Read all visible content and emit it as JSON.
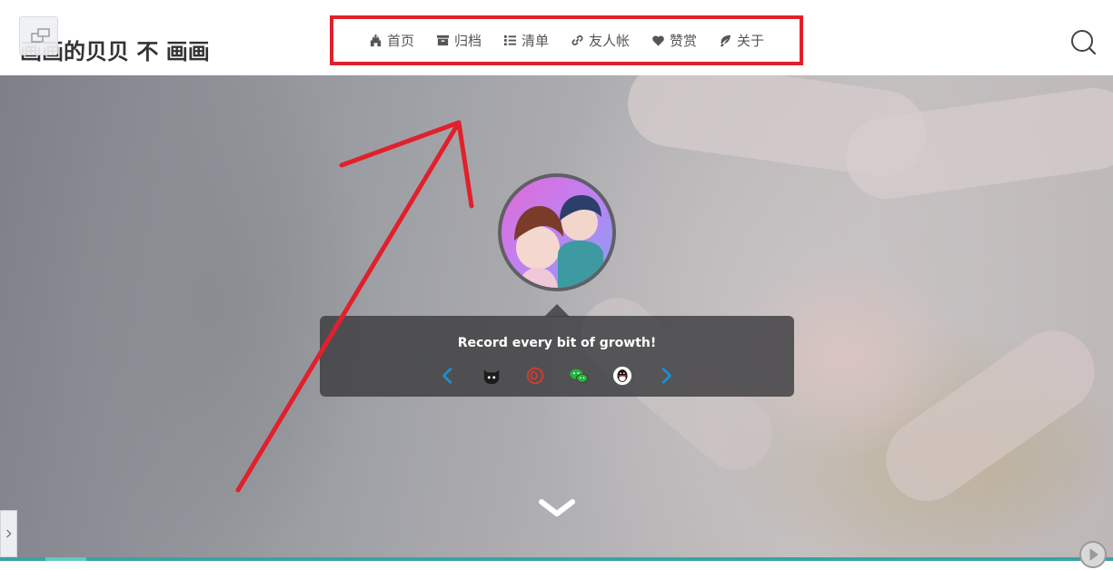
{
  "header": {
    "site_title": "画画的贝贝 不 画画"
  },
  "nav": {
    "items": [
      {
        "label": "首页",
        "icon": "castle-icon"
      },
      {
        "label": "归档",
        "icon": "archive-icon"
      },
      {
        "label": "清单",
        "icon": "list-icon"
      },
      {
        "label": "友人帐",
        "icon": "link-icon"
      },
      {
        "label": "赞赏",
        "icon": "heart-icon"
      },
      {
        "label": "关于",
        "icon": "leaf-icon"
      }
    ]
  },
  "hero": {
    "motto": "Record every bit of growth!",
    "socials": [
      "github-icon",
      "netease-music-icon",
      "wechat-icon",
      "qq-icon"
    ]
  },
  "colors": {
    "annotation_red": "#e0212b",
    "nav_text": "#555555",
    "social_arrow_blue": "#1a8fd6",
    "netease_red": "#d23c2d",
    "wechat_green": "#22b73a",
    "bottom_bar": "#3aa3a3"
  }
}
